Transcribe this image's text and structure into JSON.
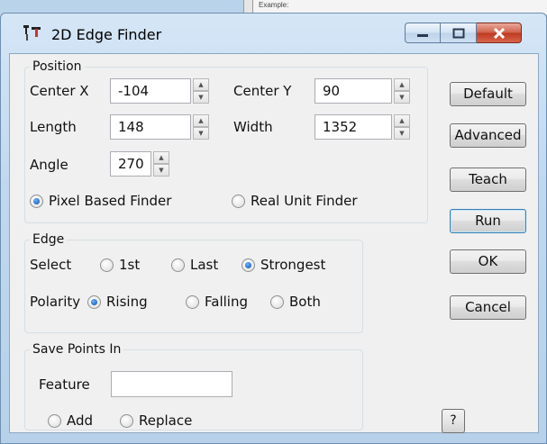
{
  "background_window": {
    "text": "Example:"
  },
  "window": {
    "title": "2D Edge Finder"
  },
  "position": {
    "legend": "Position",
    "center_x_label": "Center X",
    "center_x_value": "-104",
    "center_y_label": "Center Y",
    "center_y_value": "90",
    "length_label": "Length",
    "length_value": "148",
    "width_label": "Width",
    "width_value": "1352",
    "angle_label": "Angle",
    "angle_value": "270",
    "pixel_finder_label": "Pixel Based Finder",
    "real_unit_finder_label": "Real Unit Finder",
    "selected_finder": "Pixel Based Finder"
  },
  "edge": {
    "legend": "Edge",
    "select_label": "Select",
    "select_options": [
      "1st",
      "Last",
      "Strongest"
    ],
    "select_value": "Strongest",
    "polarity_label": "Polarity",
    "polarity_options": [
      "Rising",
      "Falling",
      "Both"
    ],
    "polarity_value": "Rising"
  },
  "save_points": {
    "legend": "Save Points In",
    "feature_label": "Feature",
    "feature_value": "",
    "add_label": "Add",
    "replace_label": "Replace"
  },
  "buttons": {
    "default": "Default",
    "advanced": "Advanced",
    "teach": "Teach",
    "run": "Run",
    "ok": "OK",
    "cancel": "Cancel",
    "help": "?"
  },
  "colors": {
    "frame": "#c0d8ef",
    "client": "#f0f0f0",
    "close_button": "#c0391f",
    "radio_selected": "#1e5fb4"
  }
}
